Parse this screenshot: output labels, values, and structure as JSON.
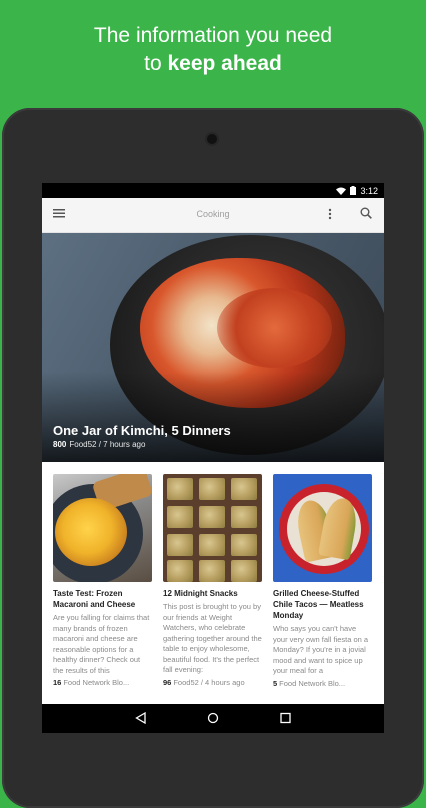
{
  "promo": {
    "line1": "The information you need",
    "line2_prefix": "to",
    "line2_bold": "keep ahead"
  },
  "status_bar": {
    "time": "3:12",
    "icons": [
      "wifi-icon",
      "battery-icon"
    ]
  },
  "app_bar": {
    "title": "Cooking",
    "icons": [
      "hamburger-menu-icon",
      "more-vert-icon",
      "search-icon"
    ]
  },
  "hero": {
    "title": "One Jar of Kimchi, 5 Dinners",
    "count": "800",
    "meta": "Food52 / 7 hours ago"
  },
  "cards": [
    {
      "title": "Taste Test: Frozen Macaroni and Cheese",
      "desc": "Are you falling for claims that many brands of frozen macaroni and cheese are reasonable options for a healthy dinner? Check out the results of this",
      "count": "16",
      "meta": "Food Network Blo..."
    },
    {
      "title": "12 Midnight Snacks",
      "desc": "This post is brought to you by our friends at Weight Watchers, who celebrate gathering together around the table to enjoy wholesome, beautiful food. It's the perfect fall evening:",
      "count": "96",
      "meta": "Food52 / 4 hours ago"
    },
    {
      "title": "Grilled Cheese-Stuffed Chile Tacos — Meatless Monday",
      "desc": "Who says you can't have your very own fall fiesta on a Monday? If you're in a jovial mood and want to spice up your meal for a",
      "count": "5",
      "meta": "Food Network Blo..."
    }
  ],
  "nav_bar": {
    "icons": [
      "back-icon",
      "home-icon",
      "recents-icon"
    ]
  },
  "colors": {
    "background": "#3bb54a",
    "device": "#2d2d2d"
  }
}
